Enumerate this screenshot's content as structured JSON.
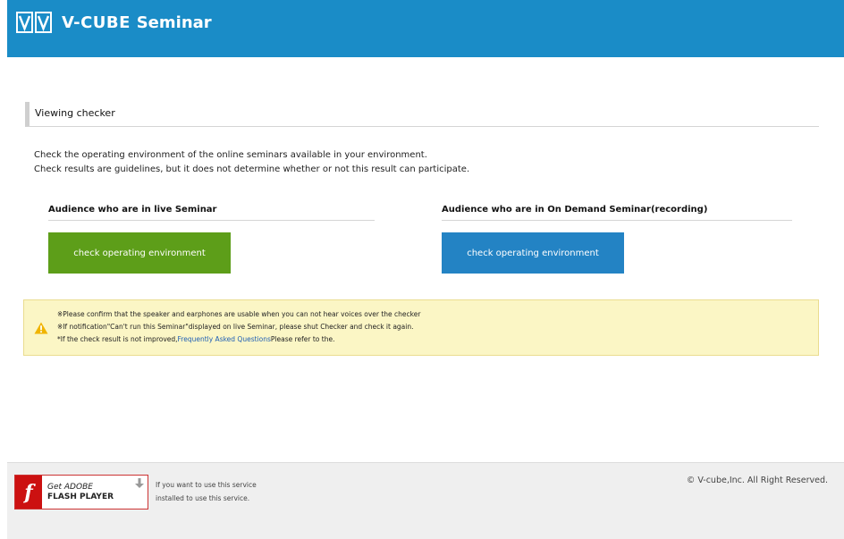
{
  "header": {
    "logo_text": "V-CUBE",
    "logo_suffix": "Seminar",
    "bg_color": "#1a8cc7"
  },
  "section": {
    "title": "Viewing checker",
    "intro_line1": "Check the operating environment of the online seminars available in your environment.",
    "intro_line2": "Check results are guidelines, but it does not determine whether or not this result can participate."
  },
  "columns": {
    "left": {
      "title": "Audience who are in live Seminar",
      "button_label": "check operating environment",
      "button_color": "#5d9e19"
    },
    "right": {
      "title": "Audience who are in On Demand Seminar(recording)",
      "button_label": "check operating environment",
      "button_color": "#2383c4"
    }
  },
  "notice": {
    "icon": "warning-icon",
    "line1": "※Please confirm that the speaker and earphones are usable when you can not hear voices over the checker",
    "line2": "※If notification\"Can't run this Seminar\"displayed on live Seminar, please shut Checker and check it again.",
    "line3_prefix": "*If the check result is not improved,",
    "line3_link": "Frequently Asked Questions",
    "line3_suffix": "Please refer to the."
  },
  "footer": {
    "flash_badge": {
      "get": "Get ADOBE",
      "player": "FLASH PLAYER",
      "icon": "flash-icon"
    },
    "flash_desc_line1": "If you want to use this service",
    "flash_desc_line2": "installed to use this service.",
    "copyright": "© V-cube,Inc. All Right Reserved."
  }
}
